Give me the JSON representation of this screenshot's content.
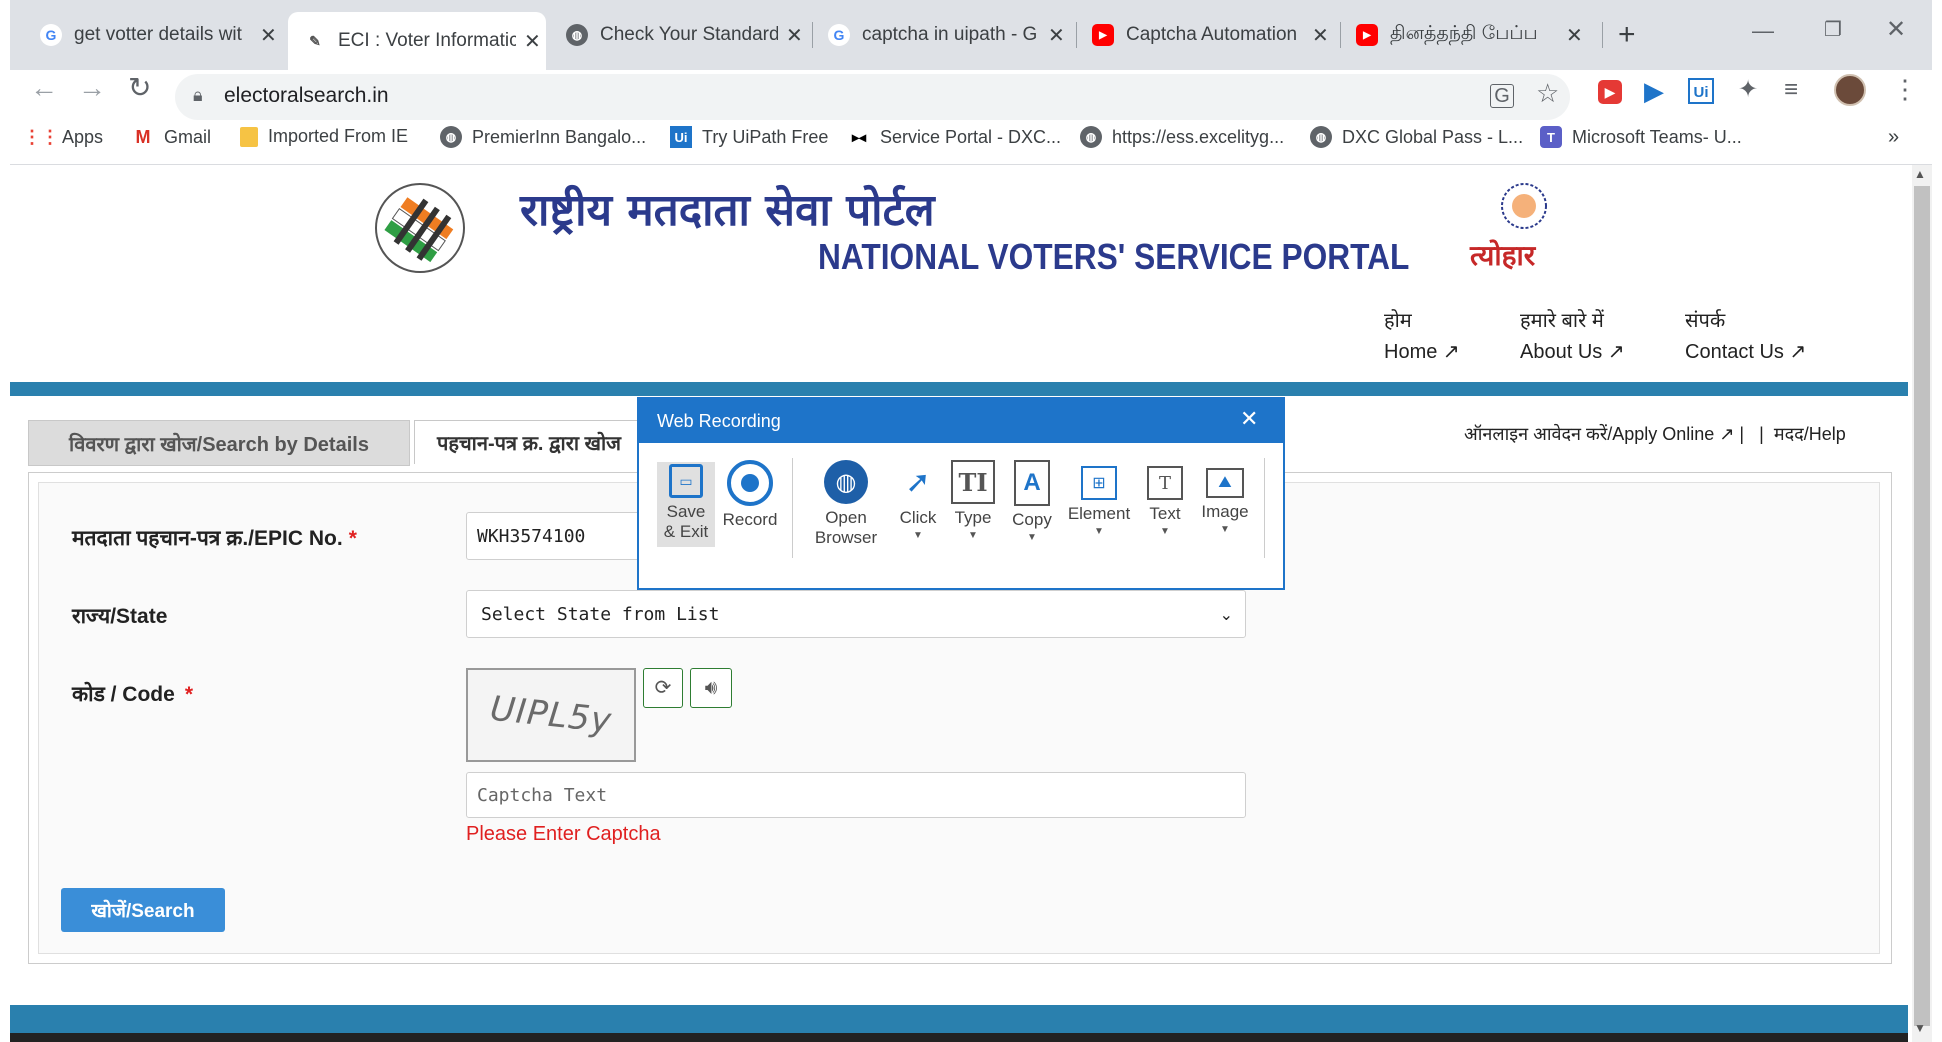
{
  "browser": {
    "tabs": [
      {
        "title": "get votter details wit",
        "favicon": "google-icon"
      },
      {
        "title": "ECI : Voter Informatic",
        "favicon": "eci-icon",
        "active": true
      },
      {
        "title": "Check Your Standard",
        "favicon": "globe-icon"
      },
      {
        "title": "captcha in uipath - G",
        "favicon": "google-icon"
      },
      {
        "title": "Captcha Automation",
        "favicon": "youtube-icon"
      },
      {
        "title": "தினத்தந்தி பேப்ப",
        "favicon": "youtube-icon"
      }
    ],
    "new_tab_symbol": "+",
    "close_symbol": "✕",
    "url": "electoralsearch.in",
    "bookmarks": [
      {
        "label": "Apps",
        "icon": "apps-grid-icon"
      },
      {
        "label": "Gmail",
        "icon": "gmail-icon"
      },
      {
        "label": "Imported From IE",
        "icon": "folder-icon"
      },
      {
        "label": "PremierInn Bangalo...",
        "icon": "globe-icon"
      },
      {
        "label": "Try UiPath Free",
        "icon": "uipath-icon"
      },
      {
        "label": "Service Portal - DXC...",
        "icon": "dxc-icon"
      },
      {
        "label": "https://ess.excelityg...",
        "icon": "globe-icon"
      },
      {
        "label": "DXC Global Pass - L...",
        "icon": "globe-icon"
      },
      {
        "label": "Microsoft Teams- U...",
        "icon": "teams-icon"
      }
    ],
    "more_bookmarks": "»"
  },
  "header": {
    "hindi_title": "राष्ट्रीय मतदाता सेवा पोर्टल",
    "english_title": "NATIONAL VOTERS' SERVICE PORTAL",
    "nav": [
      {
        "hindi": "होम",
        "english": "Home"
      },
      {
        "hindi": "हमारे बारे में",
        "english": "About Us"
      },
      {
        "hindi": "संपर्क",
        "english": "Contact Us"
      }
    ],
    "desh_logo_text": "त्योहार"
  },
  "tabs": {
    "search_by_details": "विवरण द्वारा खोज/Search by Details",
    "search_by_epic": "पहचान-पत्र क्र. द्वारा खोज",
    "apply_online": "ऑनलाइन आवेदन करें/Apply Online",
    "help": "मदद/Help",
    "divider": "|"
  },
  "form": {
    "epic_label": "मतदाता पहचान-पत्र क्र./EPIC No.",
    "epic_value": "WKH3574100",
    "state_label": "राज्य/State",
    "state_value": "Select State from List",
    "code_label": "कोड / Code",
    "required_mark": "*",
    "captcha_image_text": "UIPL5y",
    "captcha_placeholder": "Captcha Text",
    "captcha_error": "Please Enter Captcha",
    "search_button": "खोजें/Search"
  },
  "web_recording": {
    "title": "Web Recording",
    "items": [
      {
        "label": "Save\n& Exit",
        "icon": "save-icon",
        "dropdown": false
      },
      {
        "label": "Record",
        "icon": "record-icon",
        "dropdown": false
      },
      {
        "label": "Open\nBrowser",
        "icon": "open-browser-icon",
        "dropdown": true
      },
      {
        "label": "Click",
        "icon": "click-icon",
        "dropdown": true
      },
      {
        "label": "Type",
        "icon": "type-icon",
        "dropdown": true
      },
      {
        "label": "Copy",
        "icon": "copy-icon",
        "dropdown": true
      },
      {
        "label": "Element",
        "icon": "element-icon",
        "dropdown": true
      },
      {
        "label": "Text",
        "icon": "text-icon",
        "dropdown": true
      },
      {
        "label": "Image",
        "icon": "image-icon",
        "dropdown": true
      }
    ]
  },
  "colors": {
    "portal_blue": "#2b3a8c",
    "bar_blue": "#2a80ae",
    "recording_blue": "#1e74c9",
    "error_red": "#e02020",
    "search_button": "#3a8ed8"
  }
}
